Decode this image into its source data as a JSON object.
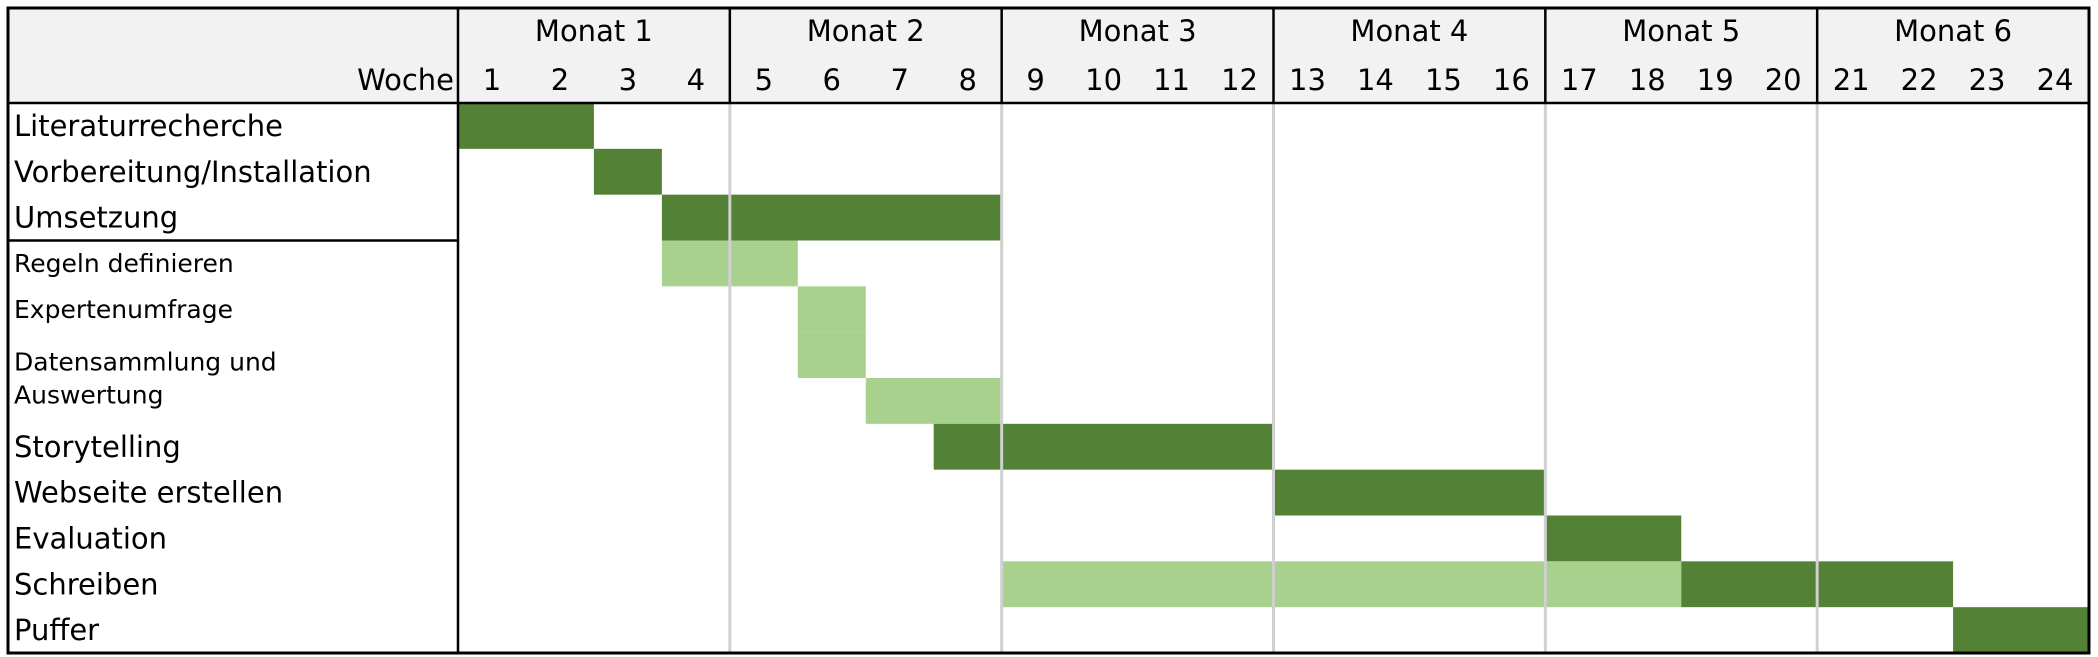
{
  "chart_data": {
    "type": "gantt",
    "week_header_label": "Woche",
    "months": [
      {
        "label": "Monat 1",
        "weeks": [
          1,
          4
        ]
      },
      {
        "label": "Monat 2",
        "weeks": [
          5,
          8
        ]
      },
      {
        "label": "Monat 3",
        "weeks": [
          9,
          12
        ]
      },
      {
        "label": "Monat 4",
        "weeks": [
          13,
          16
        ]
      },
      {
        "label": "Monat 5",
        "weeks": [
          17,
          20
        ]
      },
      {
        "label": "Monat 6",
        "weeks": [
          21,
          24
        ]
      }
    ],
    "weeks": [
      "1",
      "2",
      "3",
      "4",
      "5",
      "6",
      "7",
      "8",
      "9",
      "10",
      "11",
      "12",
      "13",
      "14",
      "15",
      "16",
      "17",
      "18",
      "19",
      "20",
      "21",
      "22",
      "23",
      "24"
    ],
    "tasks": [
      {
        "name": [
          "Literaturrecherche"
        ],
        "level": "main",
        "bars": [
          {
            "start": 1,
            "end": 2,
            "style": "dark"
          }
        ]
      },
      {
        "name": [
          "Vorbereitung/Installation"
        ],
        "level": "main",
        "bars": [
          {
            "start": 3,
            "end": 3,
            "style": "dark"
          }
        ]
      },
      {
        "name": [
          "Umsetzung"
        ],
        "level": "main",
        "bars": [
          {
            "start": 4,
            "end": 8,
            "style": "dark"
          }
        ]
      },
      {
        "name": [
          "Regeln definieren"
        ],
        "level": "sub",
        "bars": [
          {
            "start": 4,
            "end": 5,
            "style": "light"
          }
        ]
      },
      {
        "name": [
          "Expertenumfrage"
        ],
        "level": "sub",
        "bars": [
          {
            "start": 6,
            "end": 6,
            "style": "light"
          }
        ]
      },
      {
        "name": [
          "Datensammlung und",
          "Auswertung"
        ],
        "level": "sub",
        "bars": [
          {
            "start": 6,
            "end": 6,
            "style": "light",
            "part": "top"
          },
          {
            "start": 7,
            "end": 8,
            "style": "light",
            "part": "bottom"
          }
        ]
      },
      {
        "name": [
          "Storytelling"
        ],
        "level": "main",
        "bars": [
          {
            "start": 8,
            "end": 12,
            "style": "dark"
          }
        ]
      },
      {
        "name": [
          "Webseite erstellen"
        ],
        "level": "main",
        "bars": [
          {
            "start": 13,
            "end": 16,
            "style": "dark"
          }
        ]
      },
      {
        "name": [
          "Evaluation"
        ],
        "level": "main",
        "bars": [
          {
            "start": 17,
            "end": 18,
            "style": "dark"
          }
        ]
      },
      {
        "name": [
          "Schreiben"
        ],
        "level": "main",
        "bars": [
          {
            "start": 9,
            "end": 18,
            "style": "light"
          },
          {
            "start": 19,
            "end": 22,
            "style": "dark"
          }
        ]
      },
      {
        "name": [
          "Puffer"
        ],
        "level": "main",
        "bars": [
          {
            "start": 23,
            "end": 24,
            "style": "dark"
          }
        ]
      }
    ],
    "colors": {
      "dark_bar": "#538135",
      "light_bar": "#A9D18E",
      "header_bg": "#F2F2F2",
      "grid_line": "#D0D0D0",
      "border": "#000000"
    }
  }
}
